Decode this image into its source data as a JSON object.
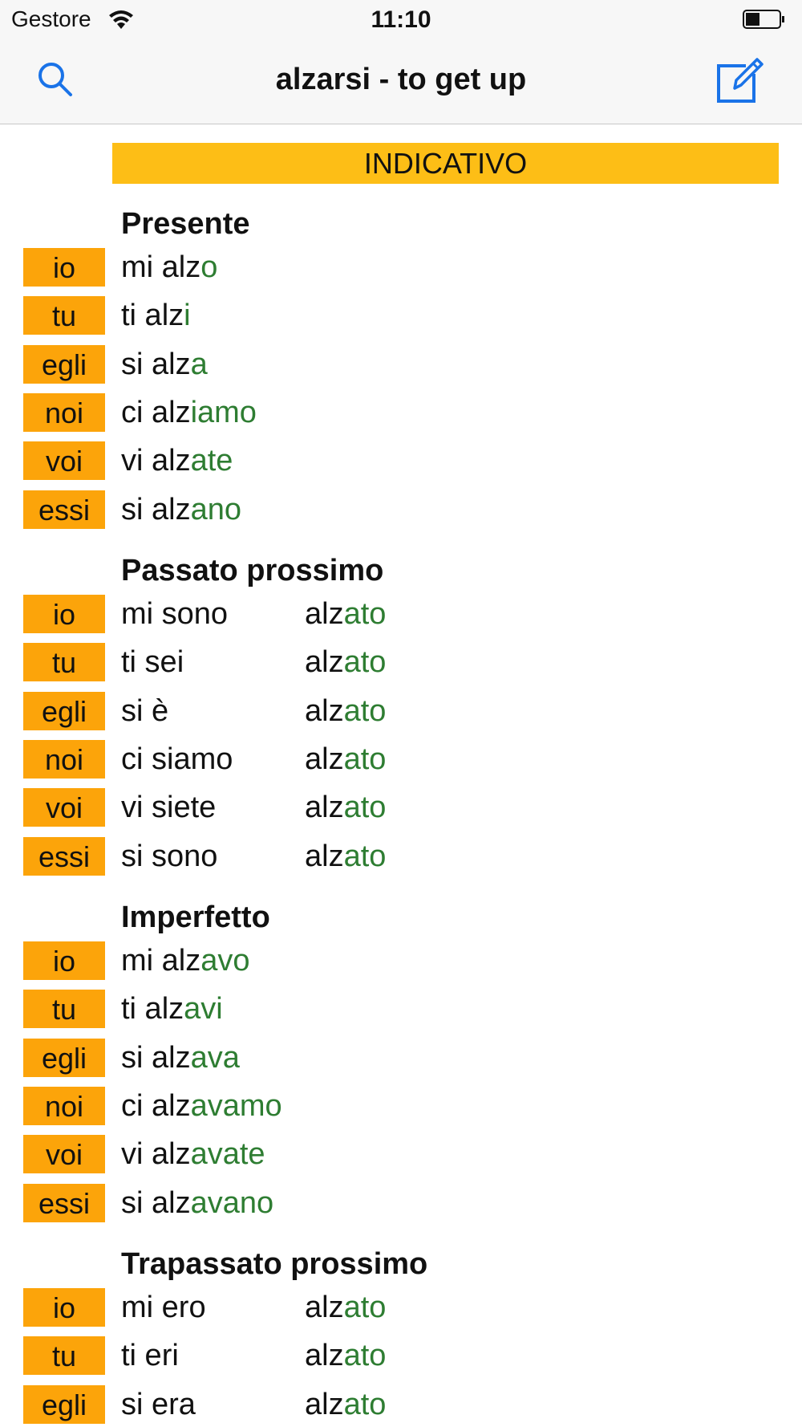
{
  "status_bar": {
    "carrier": "Gestore",
    "time": "11:10",
    "wifi_icon": "wifi-icon",
    "battery_icon": "battery-icon"
  },
  "nav": {
    "title": "alzarsi - to get up",
    "search_icon": "search-icon",
    "edit_icon": "edit-icon",
    "accent_color": "#1a73e8"
  },
  "colors": {
    "mood_header_bg": "#fdbe16",
    "pronoun_bg": "#fca40a",
    "ending_color": "#2e7d32"
  },
  "mood": "INDICATIVO",
  "sections": [
    {
      "title": "Presente",
      "rows": [
        {
          "pronoun": "io",
          "stem": "mi alz",
          "ending": "o"
        },
        {
          "pronoun": "tu",
          "stem": "ti alz",
          "ending": "i"
        },
        {
          "pronoun": "egli",
          "stem": "si alz",
          "ending": "a"
        },
        {
          "pronoun": "noi",
          "stem": "ci alz",
          "ending": "iamo"
        },
        {
          "pronoun": "voi",
          "stem": "vi alz",
          "ending": "ate"
        },
        {
          "pronoun": "essi",
          "stem": "si alz",
          "ending": "ano"
        }
      ]
    },
    {
      "title": "Passato prossimo",
      "rows": [
        {
          "pronoun": "io",
          "aux": "mi sono",
          "p_stem": "alz",
          "p_ending": "ato"
        },
        {
          "pronoun": "tu",
          "aux": "ti sei",
          "p_stem": "alz",
          "p_ending": "ato"
        },
        {
          "pronoun": "egli",
          "aux": "si è",
          "p_stem": "alz",
          "p_ending": "ato"
        },
        {
          "pronoun": "noi",
          "aux": "ci siamo",
          "p_stem": "alz",
          "p_ending": "ato"
        },
        {
          "pronoun": "voi",
          "aux": "vi siete",
          "p_stem": "alz",
          "p_ending": "ato"
        },
        {
          "pronoun": "essi",
          "aux": "si sono",
          "p_stem": "alz",
          "p_ending": "ato"
        }
      ]
    },
    {
      "title": "Imperfetto",
      "rows": [
        {
          "pronoun": "io",
          "stem": "mi alz",
          "ending": "avo"
        },
        {
          "pronoun": "tu",
          "stem": "ti alz",
          "ending": "avi"
        },
        {
          "pronoun": "egli",
          "stem": "si alz",
          "ending": "ava"
        },
        {
          "pronoun": "noi",
          "stem": "ci alz",
          "ending": "avamo"
        },
        {
          "pronoun": "voi",
          "stem": "vi alz",
          "ending": "avate"
        },
        {
          "pronoun": "essi",
          "stem": "si alz",
          "ending": "avano"
        }
      ]
    },
    {
      "title": "Trapassato prossimo",
      "rows": [
        {
          "pronoun": "io",
          "aux": "mi ero",
          "p_stem": "alz",
          "p_ending": "ato"
        },
        {
          "pronoun": "tu",
          "aux": "ti eri",
          "p_stem": "alz",
          "p_ending": "ato"
        },
        {
          "pronoun": "egli",
          "aux": "si era",
          "p_stem": "alz",
          "p_ending": "ato"
        }
      ]
    }
  ]
}
